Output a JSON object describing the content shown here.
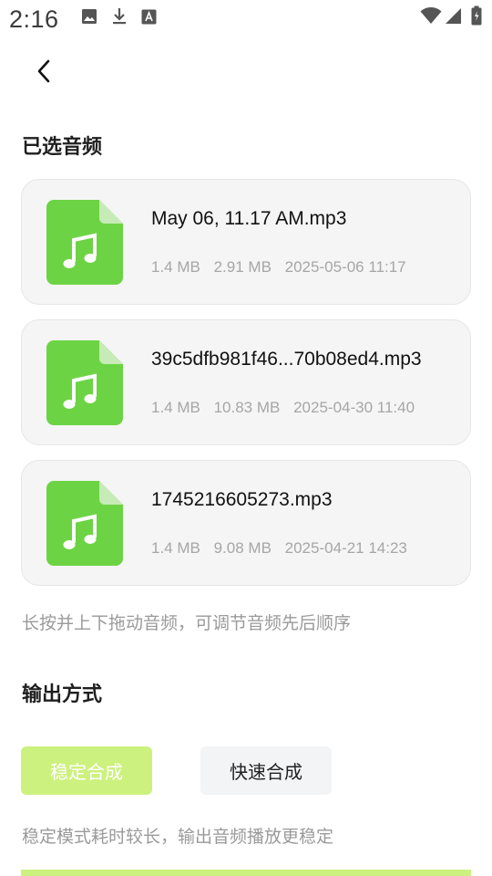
{
  "status_bar": {
    "time": "2:16"
  },
  "selected_audio": {
    "title": "已选音频",
    "files": [
      {
        "name": "May 06, 11.17 AM.mp3",
        "size1": "1.4 MB",
        "size2": "2.91 MB",
        "datetime": "2025-05-06 11:17"
      },
      {
        "name": "39c5dfb981f46...70b08ed4.mp3",
        "size1": "1.4 MB",
        "size2": "10.83 MB",
        "datetime": "2025-04-30 11:40"
      },
      {
        "name": "1745216605273.mp3",
        "size1": "1.4 MB",
        "size2": "9.08 MB",
        "datetime": "2025-04-21 14:23"
      }
    ],
    "hint": "长按并上下拖动音频，可调节音频先后顺序"
  },
  "output_mode": {
    "title": "输出方式",
    "stable_label": "稳定合成",
    "fast_label": "快速合成",
    "description": "稳定模式耗时较长，输出音频播放更稳定"
  },
  "colors": {
    "accent": "#cdf17e",
    "file_icon": "#6cd444",
    "card_bg": "#f5f5f5"
  },
  "icons": [
    "image-icon",
    "download-icon",
    "font-icon",
    "wifi-icon",
    "signal-icon",
    "battery-icon",
    "back-icon",
    "music-file-icon"
  ]
}
